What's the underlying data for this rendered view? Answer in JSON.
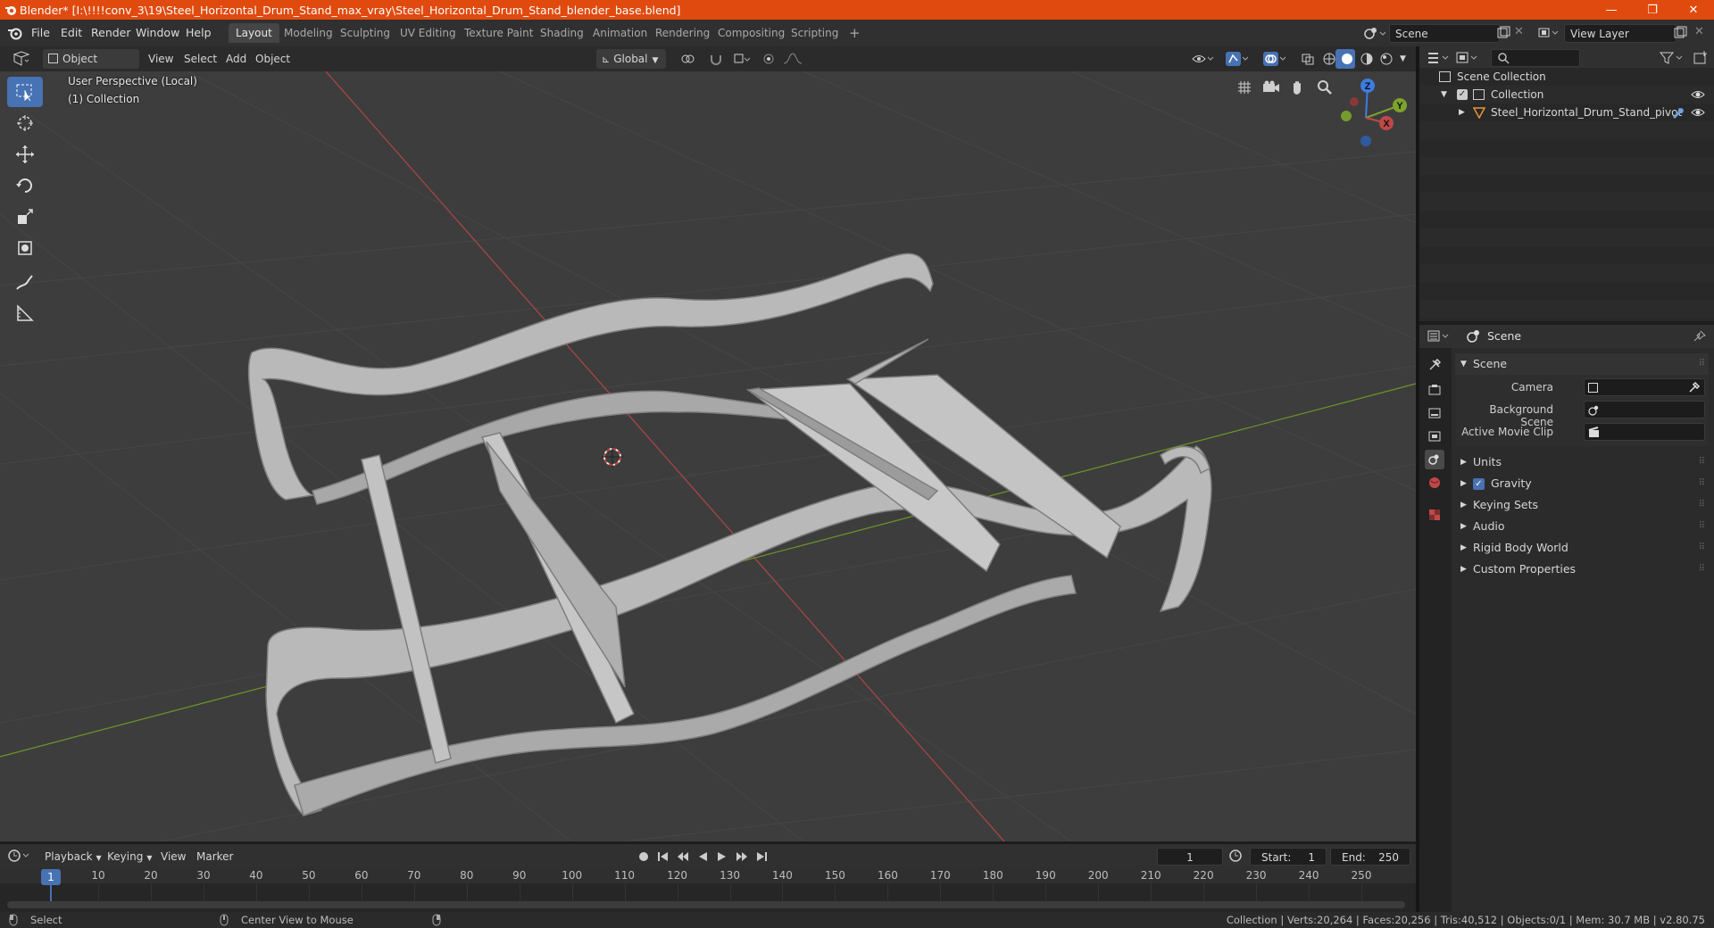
{
  "window": {
    "title": "Blender* [I:\\!!!!conv_3\\19\\Steel_Horizontal_Drum_Stand_max_vray\\Steel_Horizontal_Drum_Stand_blender_base.blend]",
    "controls": [
      "—",
      "❐",
      "✕"
    ]
  },
  "menubar": {
    "menus": [
      "File",
      "Edit",
      "Render",
      "Window",
      "Help"
    ],
    "workspaces": [
      "Layout",
      "Modeling",
      "Sculpting",
      "UV Editing",
      "Texture Paint",
      "Shading",
      "Animation",
      "Rendering",
      "Compositing",
      "Scripting"
    ],
    "active_workspace": "Layout",
    "add_tab": "+",
    "scene": "Scene",
    "view_layer": "View Layer"
  },
  "viewport_header": {
    "mode": "Object Mode",
    "menus": [
      "View",
      "Select",
      "Add",
      "Object"
    ],
    "orientation": "Global"
  },
  "viewport": {
    "perspective_label": "User Perspective (Local)",
    "collection_label": "(1) Collection",
    "gizmo_axes": [
      "Z",
      "Y",
      "X"
    ],
    "tools": [
      "select-box-icon",
      "cursor-icon",
      "move-icon",
      "rotate-icon",
      "scale-icon",
      "transform-icon",
      "annotate-icon",
      "measure-icon"
    ]
  },
  "outliner": {
    "search_placeholder": "",
    "root": "Scene Collection",
    "collection": "Collection",
    "object": "Steel_Horizontal_Drum_Stand_pivot"
  },
  "properties": {
    "header": "Scene",
    "panel_title": "Scene",
    "fields": [
      {
        "label": "Camera",
        "value": ""
      },
      {
        "label": "Background Scene",
        "value": ""
      },
      {
        "label": "Active Movie Clip",
        "value": ""
      }
    ],
    "subpanels": [
      "Units",
      "Gravity",
      "Keying Sets",
      "Audio",
      "Rigid Body World",
      "Custom Properties"
    ],
    "gravity_checked": true
  },
  "timeline": {
    "menus": [
      "Playback",
      "Keying",
      "View",
      "Marker"
    ],
    "current_frame": "1",
    "start_label": "Start:",
    "start": "1",
    "end_label": "End:",
    "end": "250",
    "ticks": [
      "1",
      "10",
      "20",
      "30",
      "40",
      "50",
      "60",
      "70",
      "80",
      "90",
      "100",
      "110",
      "120",
      "130",
      "140",
      "150",
      "160",
      "170",
      "180",
      "190",
      "200",
      "210",
      "220",
      "230",
      "240",
      "250"
    ]
  },
  "statusbar": {
    "left_action": "Select",
    "middle_action": "Center View to Mouse",
    "stats": "Collection | Verts:20,264 | Faces:20,256 | Tris:40,512 | Objects:0/1 | Mem: 30.7 MB | v2.80.75"
  },
  "colors": {
    "title_bar": "#e14a0e",
    "accent": "#4772b3",
    "viewport_bg": "#3d3d3d",
    "x_axis": "#c04848",
    "y_axis": "#7da42a"
  }
}
